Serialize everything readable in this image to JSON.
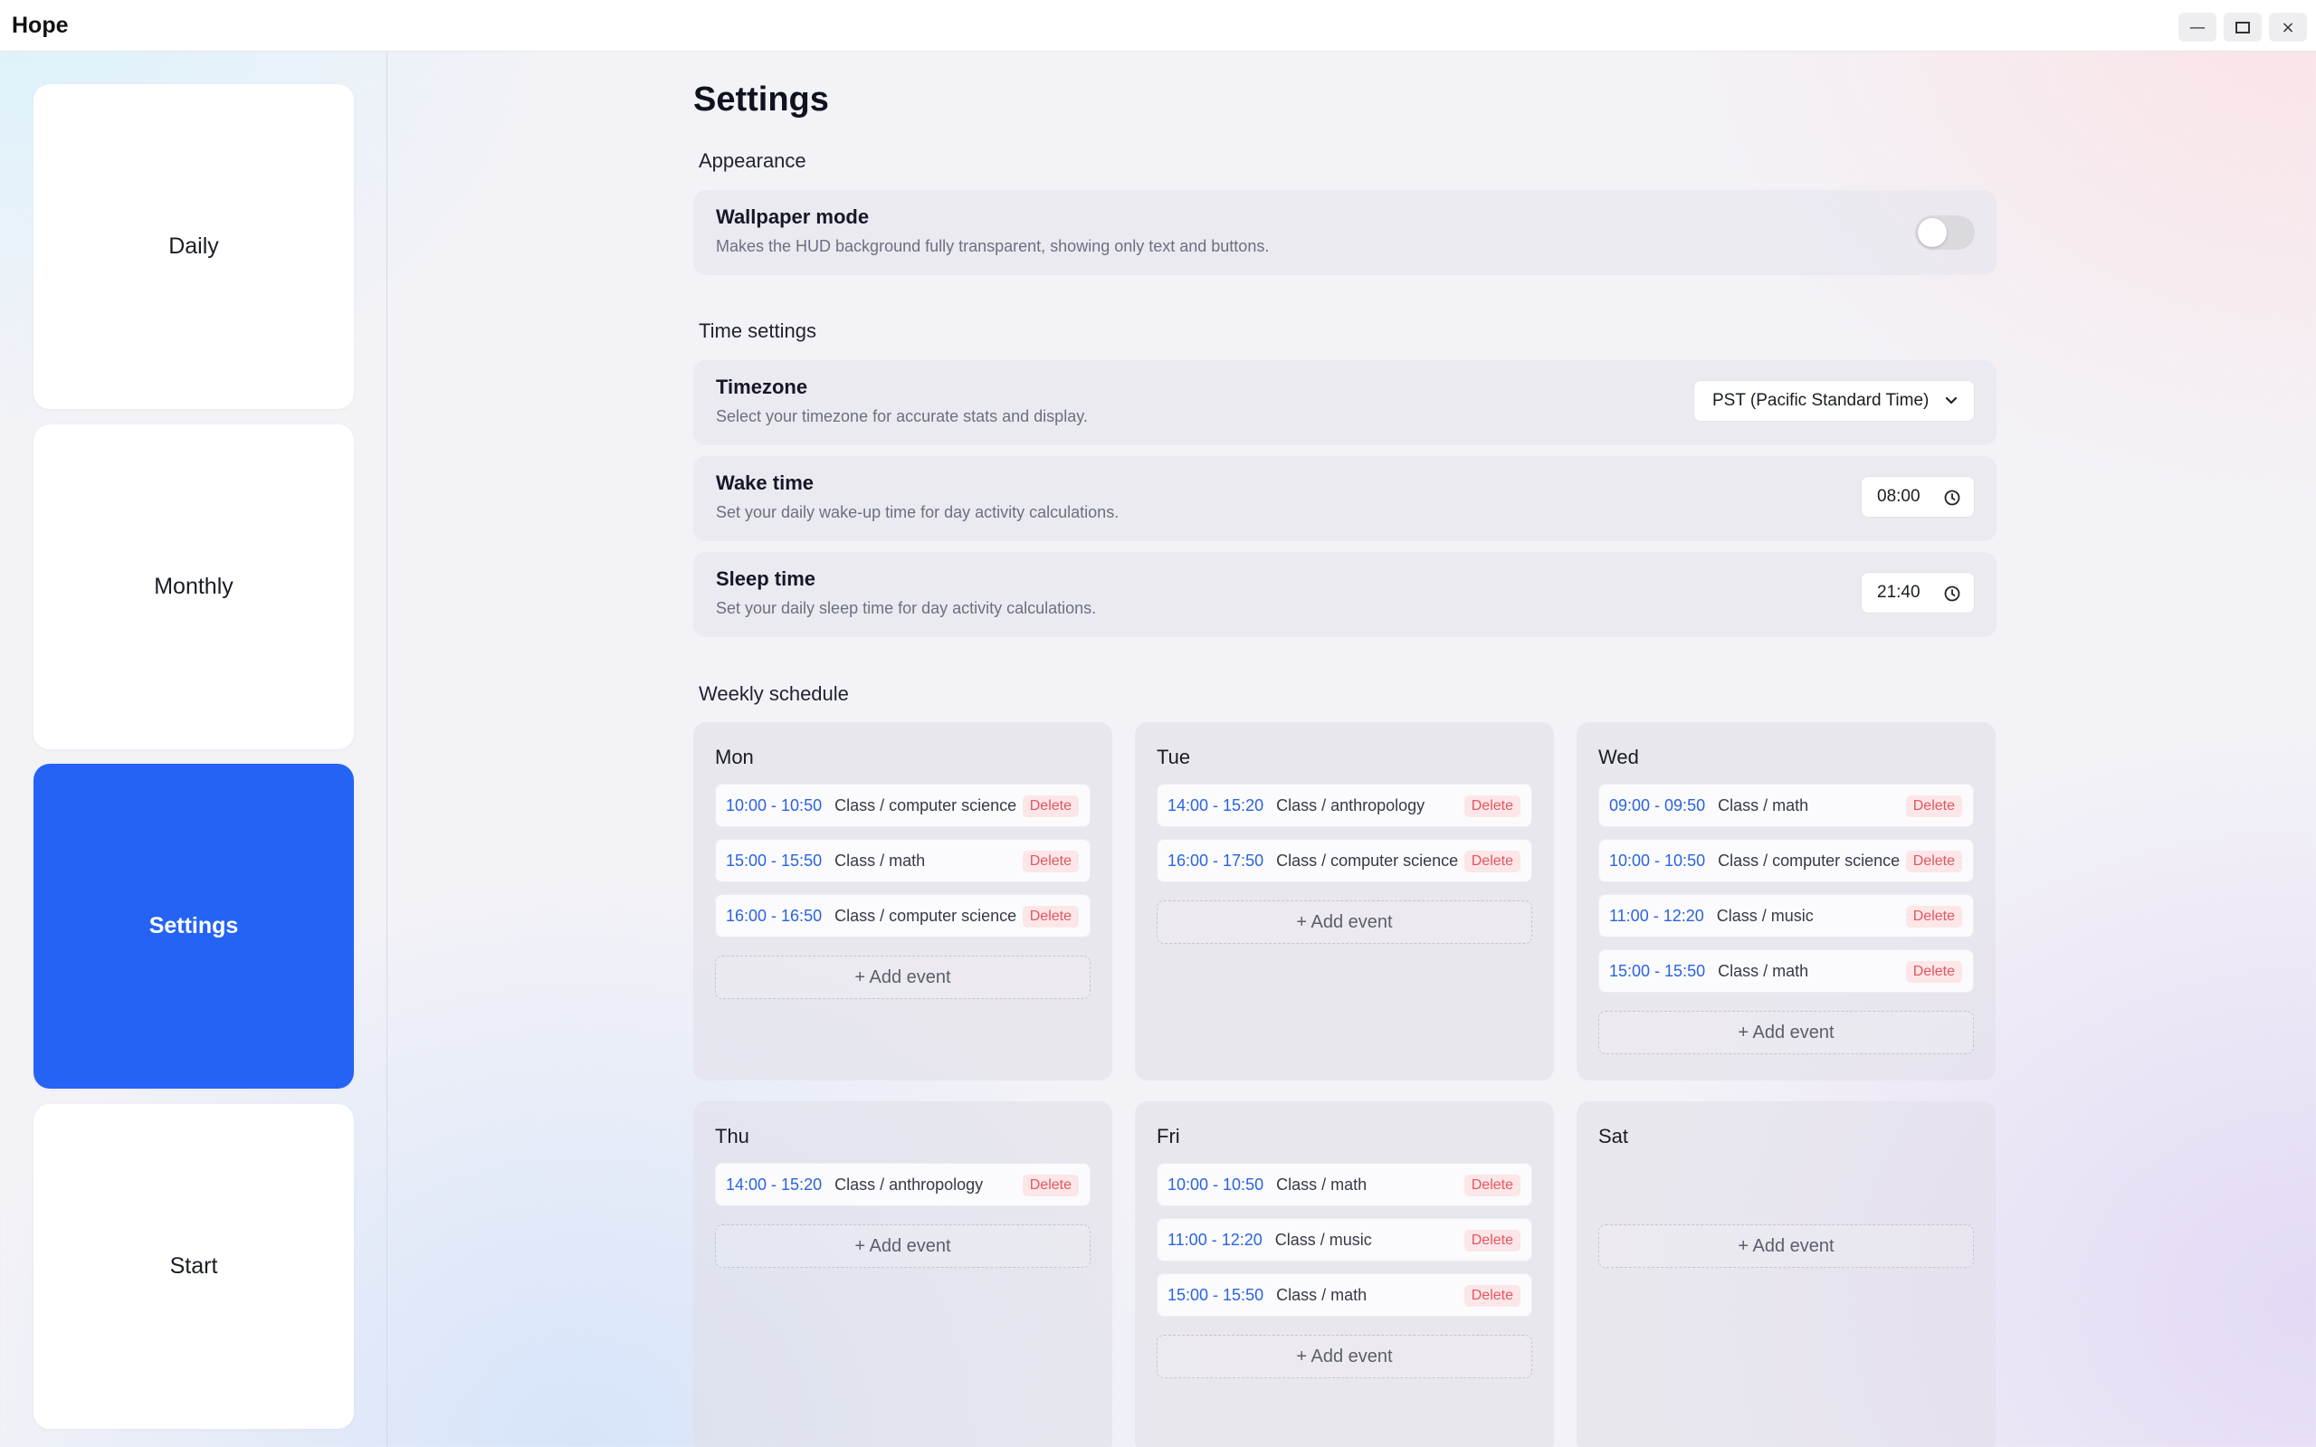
{
  "window": {
    "title": "Hope",
    "controls": [
      "—",
      "",
      "×"
    ]
  },
  "sidebar": {
    "items": [
      {
        "label": "Daily",
        "active": false
      },
      {
        "label": "Monthly",
        "active": false
      },
      {
        "label": "Settings",
        "active": true
      },
      {
        "label": "Start",
        "active": false
      }
    ]
  },
  "page": {
    "title": "Settings"
  },
  "appearance": {
    "section": "Appearance",
    "wallpaper": {
      "title": "Wallpaper mode",
      "desc": "Makes the HUD background fully transparent, showing only text and buttons.",
      "enabled": false
    }
  },
  "time_settings": {
    "section": "Time settings",
    "timezone": {
      "title": "Timezone",
      "desc": "Select your timezone for accurate stats and display.",
      "value": "PST (Pacific Standard Time)"
    },
    "wake": {
      "title": "Wake time",
      "desc": "Set your daily wake-up time for day activity calculations.",
      "value": "08:00"
    },
    "sleep": {
      "title": "Sleep time",
      "desc": "Set your daily sleep time for day activity calculations.",
      "value": "21:40"
    }
  },
  "schedule": {
    "section": "Weekly schedule",
    "delete_label": "Delete",
    "add_label": "+ Add event",
    "days": {
      "mon": {
        "name": "Mon",
        "events": [
          {
            "time": "10:00 - 10:50",
            "title": "Class / computer science"
          },
          {
            "time": "15:00 - 15:50",
            "title": "Class / math"
          },
          {
            "time": "16:00 - 16:50",
            "title": "Class / computer science"
          }
        ]
      },
      "tue": {
        "name": "Tue",
        "events": [
          {
            "time": "14:00 - 15:20",
            "title": "Class / anthropology"
          },
          {
            "time": "16:00 - 17:50",
            "title": "Class / computer science"
          }
        ]
      },
      "wed": {
        "name": "Wed",
        "events": [
          {
            "time": "09:00 - 09:50",
            "title": "Class / math"
          },
          {
            "time": "10:00 - 10:50",
            "title": "Class / computer science"
          },
          {
            "time": "11:00 - 12:20",
            "title": "Class / music"
          },
          {
            "time": "15:00 - 15:50",
            "title": "Class / math"
          }
        ]
      },
      "thu": {
        "name": "Thu",
        "events": [
          {
            "time": "14:00 - 15:20",
            "title": "Class / anthropology"
          }
        ]
      },
      "fri": {
        "name": "Fri",
        "events": [
          {
            "time": "10:00 - 10:50",
            "title": "Class / math"
          },
          {
            "time": "11:00 - 12:20",
            "title": "Class / music"
          },
          {
            "time": "15:00 - 15:50",
            "title": "Class / math"
          }
        ]
      },
      "sat": {
        "name": "Sat",
        "events": []
      }
    }
  }
}
